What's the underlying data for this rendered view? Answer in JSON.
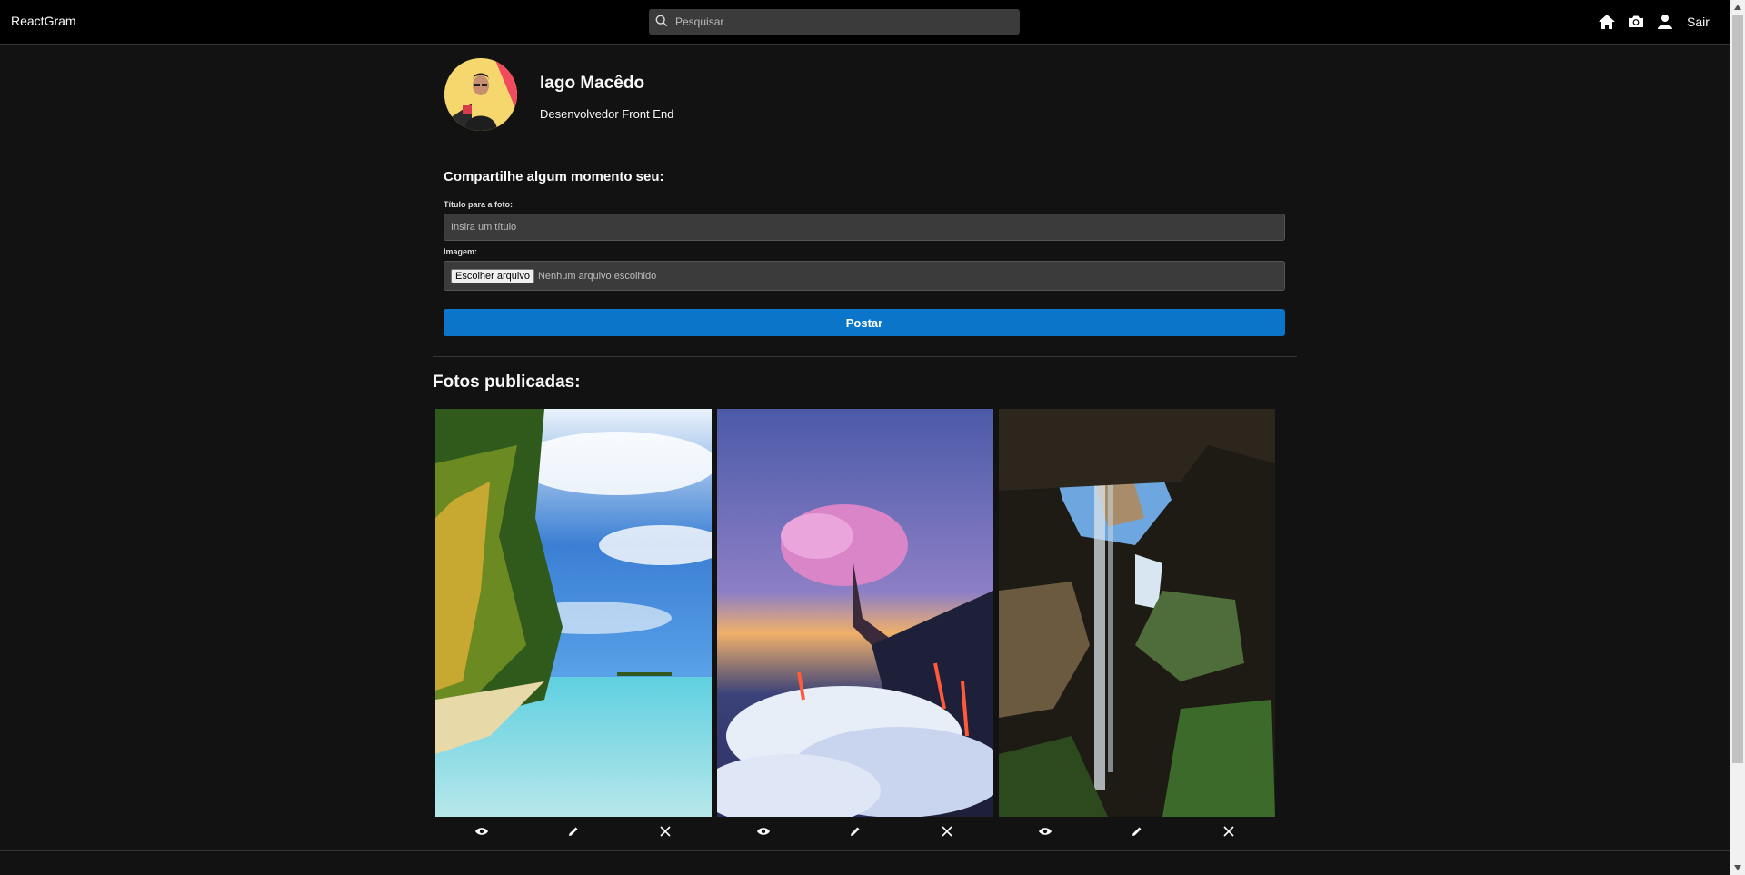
{
  "navbar": {
    "brand": "ReactGram",
    "search_placeholder": "Pesquisar",
    "icons": [
      "home-icon",
      "camera-icon",
      "user-icon"
    ],
    "logout_label": "Sair"
  },
  "profile": {
    "name": "Iago Macêdo",
    "bio": "Desenvolvedor Front End"
  },
  "new_photo": {
    "heading": "Compartilhe algum momento seu:",
    "title_label": "Título para a foto:",
    "title_placeholder": "Insira um título",
    "image_label": "Imagem:",
    "file_button": "Escolher arquivo",
    "file_status": "Nenhum arquivo escolhido",
    "submit_label": "Postar"
  },
  "photos": {
    "heading": "Fotos publicadas:",
    "items": [
      {
        "subject": "tropical beach with palm trees",
        "actions": [
          "eye-icon",
          "pencil-icon",
          "close-icon"
        ]
      },
      {
        "subject": "pink blossom tree on cliff above clouds",
        "actions": [
          "eye-icon",
          "pencil-icon",
          "close-icon"
        ]
      },
      {
        "subject": "waterfall in cave",
        "actions": [
          "eye-icon",
          "pencil-icon",
          "close-icon"
        ]
      }
    ]
  },
  "colors": {
    "background": "#121212",
    "navbar": "#000000",
    "input_bg": "#3b3b3b",
    "primary": "#0b76c9",
    "border": "#363636"
  }
}
